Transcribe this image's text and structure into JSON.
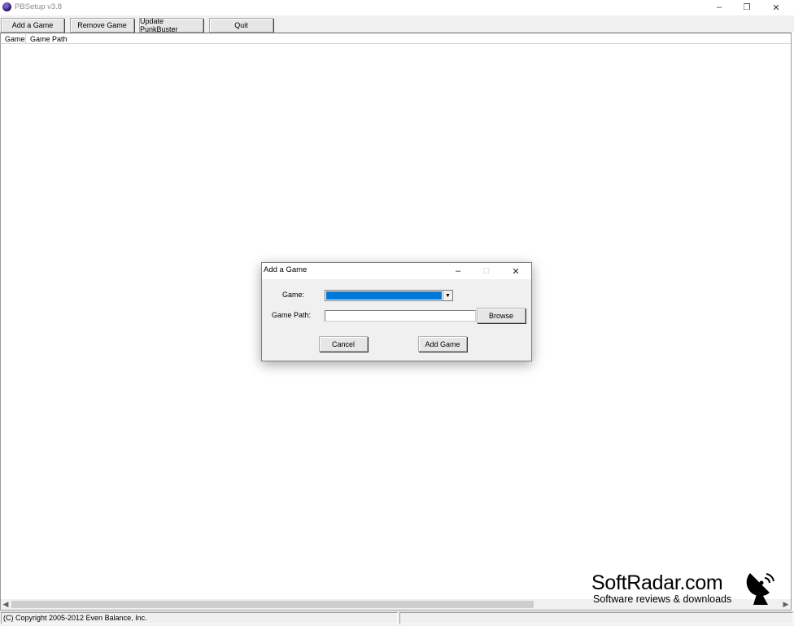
{
  "window": {
    "title": "PBSetup v3.8",
    "controls": {
      "minimize": "–",
      "restore": "❐",
      "close": "✕"
    }
  },
  "toolbar": {
    "add_game": "Add a Game",
    "remove_game": "Remove Game",
    "update_punkbuster": "Update PunkBuster",
    "quit": "Quit"
  },
  "list": {
    "columns": [
      "Game",
      "Game Path"
    ]
  },
  "status_bar": {
    "copyright": "(C) Copyright 2005-2012 Even Balance, Inc.",
    "pane2": ""
  },
  "dialog": {
    "title": "Add a Game",
    "controls": {
      "minimize": "–",
      "maximize": "□",
      "close": "✕"
    },
    "game_label": "Game:",
    "game_value": "",
    "path_label": "Game Path:",
    "path_value": "",
    "browse": "Browse",
    "cancel": "Cancel",
    "add_game": "Add Game"
  },
  "watermark": {
    "title": "SoftRadar.com",
    "subtitle": "Software reviews & downloads"
  },
  "colors": {
    "selection": "#0078d7",
    "toolbar_bg": "#f0f0f0"
  },
  "icons": [
    "app-icon",
    "chevron-down-icon",
    "scroll-left-icon",
    "scroll-right-icon",
    "satellite-dish-icon"
  ]
}
